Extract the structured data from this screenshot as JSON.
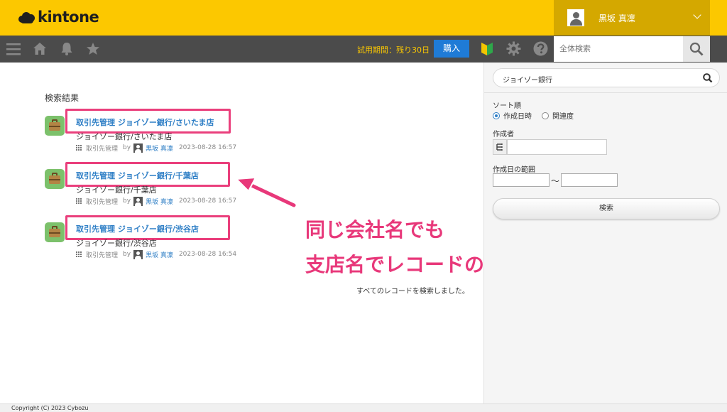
{
  "header": {
    "logo_text": "kintone",
    "user_name": "黒坂 真凜"
  },
  "navbar": {
    "trial_text": "試用期間：残り30日",
    "buy_label": "購入",
    "global_search_placeholder": "全体検索"
  },
  "results": {
    "heading": "検索結果",
    "items": [
      {
        "title": "取引先管理 ジョイゾー銀行/さいたま店",
        "subtitle": "ジョイゾー銀行/さいたま店",
        "app_name": "取引先管理",
        "by": "by",
        "author": "黒坂 真凜",
        "datetime": "2023-08-28 16:57"
      },
      {
        "title": "取引先管理 ジョイゾー銀行/千葉店",
        "subtitle": "ジョイゾー銀行/千葉店",
        "app_name": "取引先管理",
        "by": "by",
        "author": "黒坂 真凜",
        "datetime": "2023-08-28 16:57"
      },
      {
        "title": "取引先管理 ジョイゾー銀行/渋谷店",
        "subtitle": "ジョイゾー銀行/渋谷店",
        "app_name": "取引先管理",
        "by": "by",
        "author": "黒坂 真凜",
        "datetime": "2023-08-28 16:54"
      }
    ],
    "all_searched_text": "すべてのレコードを検索しました。"
  },
  "annotation": {
    "line1": "同じ会社名でも",
    "line2": "支店名でレコードの区別がつく",
    "color": "#e8387a"
  },
  "side_panel": {
    "search_value": "ジョイゾー銀行",
    "sort_label": "ソート順",
    "sort_options": [
      "作成日時",
      "関連度"
    ],
    "sort_selected": "作成日時",
    "creator_label": "作成者",
    "date_range_label": "作成日の範囲",
    "date_separator": "〜",
    "search_button_label": "検索"
  },
  "footer": {
    "copyright": "Copyright (C) 2023 Cybozu"
  },
  "colors": {
    "brand_yellow": "#fcc800",
    "navbar": "#4b4b4b",
    "link_blue": "#2f7fc6",
    "buy_blue": "#1f7bd6",
    "highlight_pink": "#ea3f7c"
  }
}
